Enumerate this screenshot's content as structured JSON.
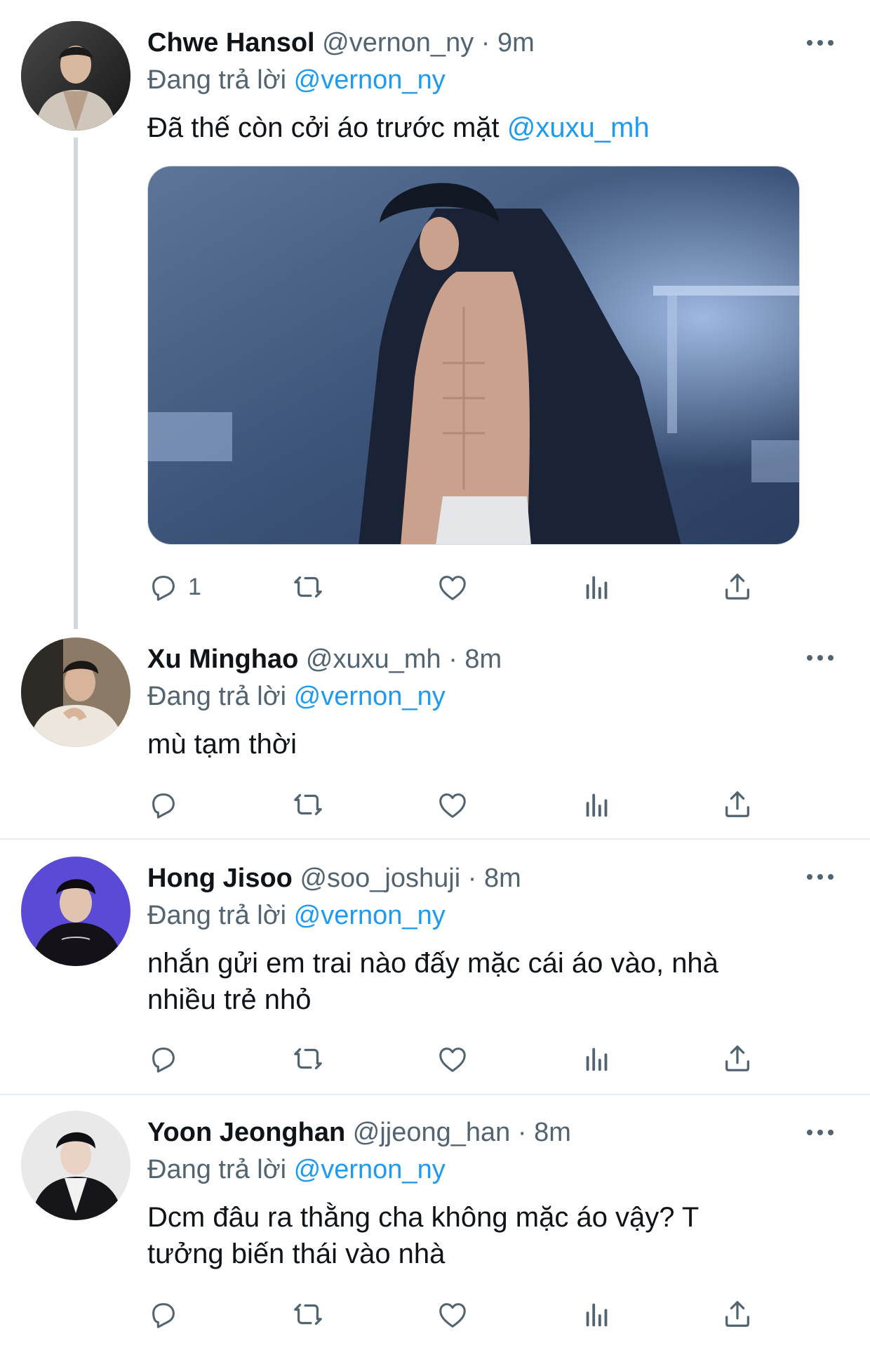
{
  "tweets": [
    {
      "name": "Chwe Hansol",
      "handle": "@vernon_ny",
      "time": "9m",
      "reply_prefix": "Đang trả lời",
      "reply_to": "@vernon_ny",
      "text": "Đã thế còn cởi áo trước mặt ",
      "text_mention": "@xuxu_mh",
      "reply_count": "1",
      "has_media": true
    },
    {
      "name": "Xu Minghao",
      "handle": "@xuxu_mh",
      "time": "8m",
      "reply_prefix": "Đang trả lời",
      "reply_to": "@vernon_ny",
      "text": "mù tạm thời"
    },
    {
      "name": "Hong Jisoo",
      "handle": "@soo_joshuji",
      "time": "8m",
      "reply_prefix": "Đang trả lời",
      "reply_to": "@vernon_ny",
      "text_line1": "nhắn gửi em trai nào đấy mặc cái áo vào, nhà",
      "text_line2": "nhiều trẻ nhỏ"
    },
    {
      "name": "Yoon Jeonghan",
      "handle": "@jjeong_han",
      "time": "8m",
      "reply_prefix": "Đang trả lời",
      "reply_to": "@vernon_ny",
      "text_line1": "Dcm đâu ra thằng cha không mặc áo vậy? T",
      "text_line2": "tưởng biến thái vào nhà"
    }
  ],
  "separator": " · ",
  "icons": {
    "reply": "reply-icon",
    "retweet": "retweet-icon",
    "like": "like-icon",
    "views": "views-icon",
    "share": "share-icon",
    "more": "more-icon"
  },
  "colors": {
    "link": "#1d9bf0",
    "secondary_text": "#536471",
    "primary_text": "#0f1419",
    "divider": "#e6ecf0"
  }
}
